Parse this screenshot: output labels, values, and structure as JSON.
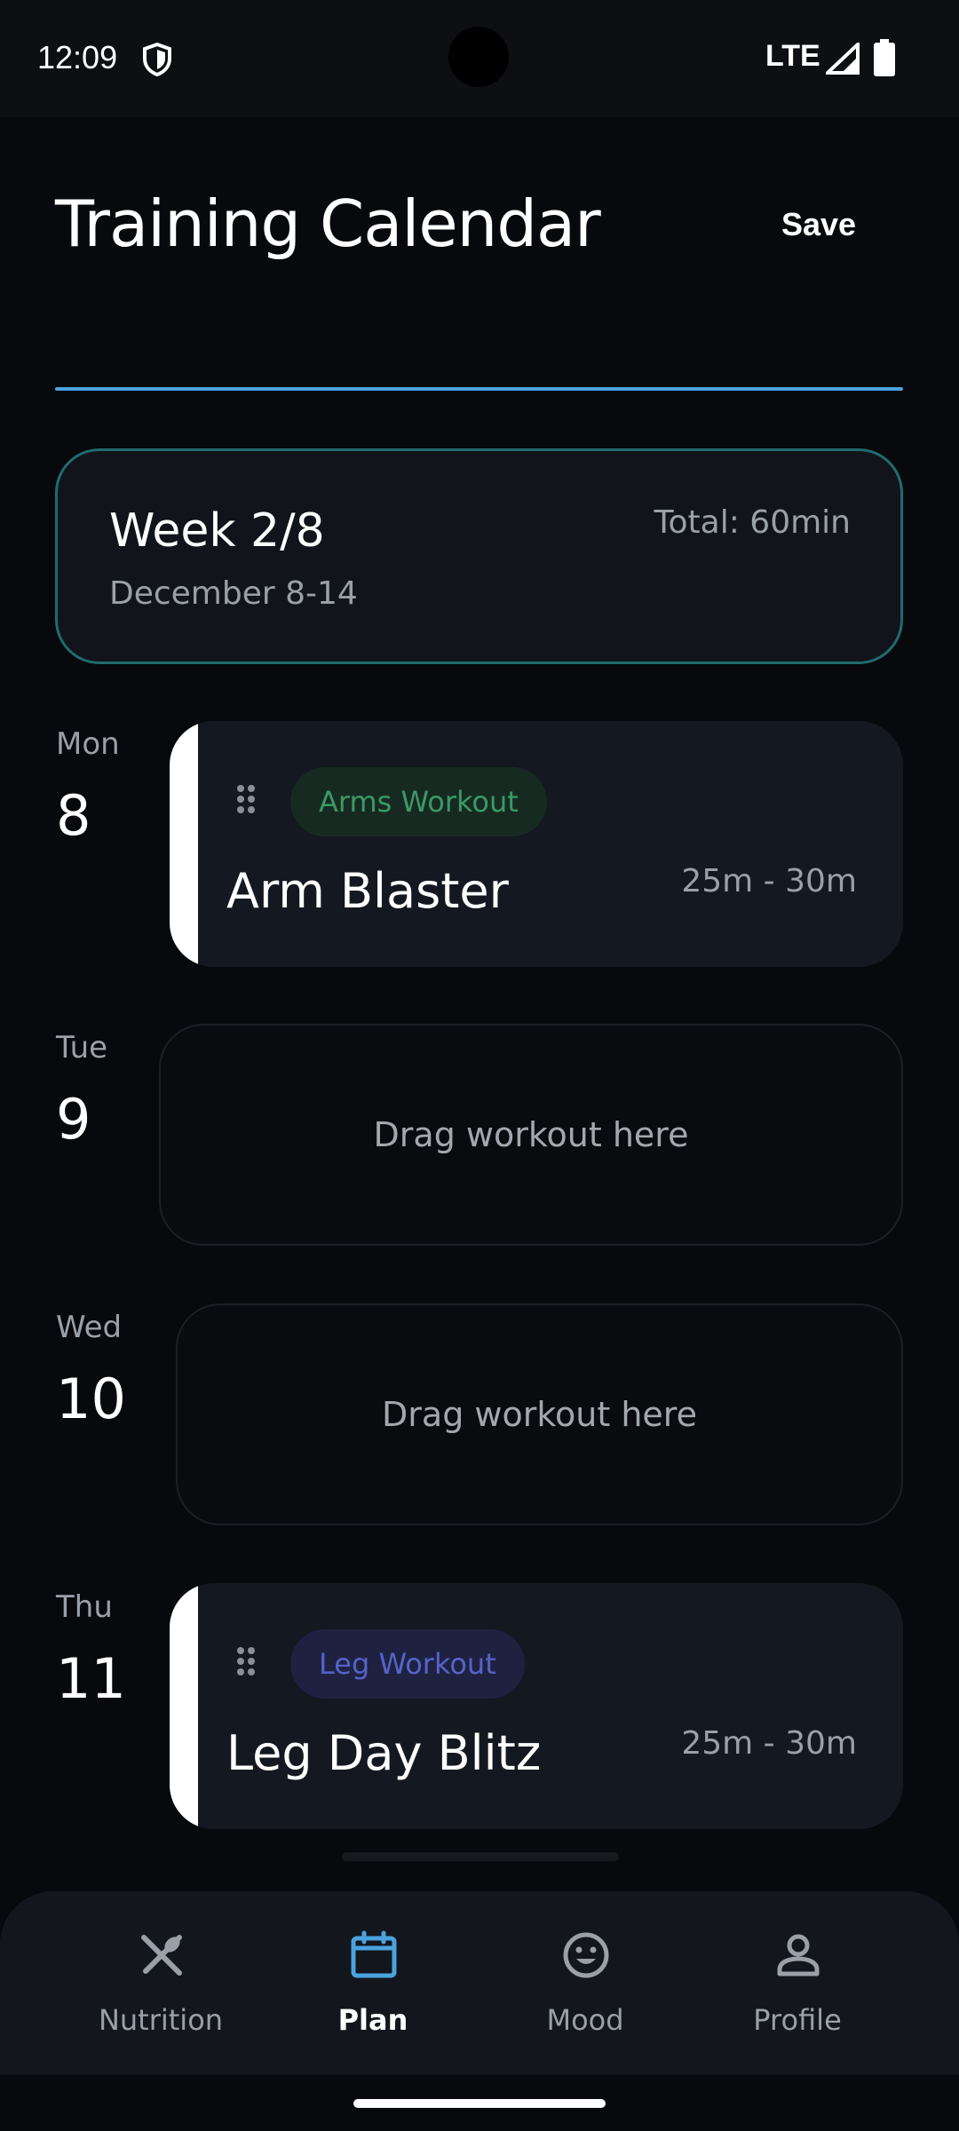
{
  "status_bar": {
    "time": "12:09",
    "network": "LTE"
  },
  "header": {
    "title": "Training Calendar",
    "save_label": "Save"
  },
  "week": {
    "title": "Week 2/8",
    "dates": "December 8-14",
    "total": "Total: 60min"
  },
  "days": [
    {
      "day": "Mon",
      "date": "8",
      "workout": {
        "tag": "Arms Workout",
        "name": "Arm Blaster",
        "duration": "25m - 30m"
      }
    },
    {
      "day": "Tue",
      "date": "9",
      "placeholder": "Drag workout here"
    },
    {
      "day": "Wed",
      "date": "10",
      "placeholder": "Drag workout here"
    },
    {
      "day": "Thu",
      "date": "11",
      "workout": {
        "tag": "Leg Workout",
        "name": "Leg Day Blitz",
        "duration": "25m - 30m"
      }
    }
  ],
  "nav": [
    {
      "label": "Nutrition",
      "icon": "fork-spoon-icon"
    },
    {
      "label": "Plan",
      "icon": "calendar-icon",
      "active": true
    },
    {
      "label": "Mood",
      "icon": "smiley-icon"
    },
    {
      "label": "Profile",
      "icon": "person-icon"
    }
  ],
  "colors": {
    "accent": "#4aa3df",
    "week_border": "#1f6b6f",
    "arms_tag_text": "#3a9a64",
    "legs_tag_text": "#5563c9"
  }
}
